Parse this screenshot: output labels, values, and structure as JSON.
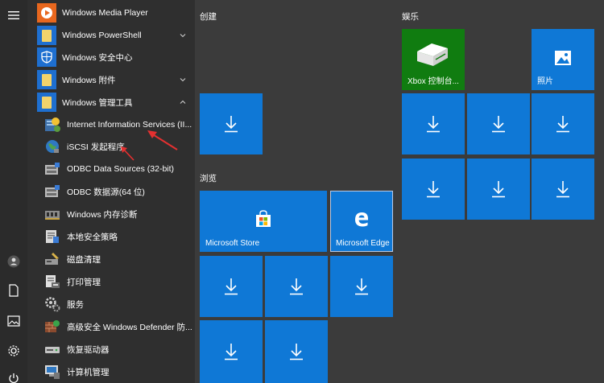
{
  "rail": {
    "icons": [
      "hamburger-icon",
      "user-icon",
      "document-icon",
      "picture-icon",
      "settings-icon",
      "power-icon"
    ]
  },
  "apps": [
    {
      "label": "Windows Media Player",
      "icon": "media-player-icon"
    },
    {
      "label": "Windows PowerShell",
      "icon": "folder-icon",
      "expand": "down"
    },
    {
      "label": "Windows 安全中心",
      "icon": "shield-icon"
    },
    {
      "label": "Windows 附件",
      "icon": "folder-icon",
      "expand": "down"
    },
    {
      "label": "Windows 管理工具",
      "icon": "folder-icon",
      "expand": "up"
    },
    {
      "label": "Internet Information Services (II...",
      "icon": "iis-icon"
    },
    {
      "label": "iSCSI 发起程序",
      "icon": "globe-icon"
    },
    {
      "label": "ODBC Data Sources (32-bit)",
      "icon": "odbc-icon"
    },
    {
      "label": "ODBC 数据源(64 位)",
      "icon": "odbc-icon"
    },
    {
      "label": "Windows 内存诊断",
      "icon": "memory-icon"
    },
    {
      "label": "本地安全策略",
      "icon": "policy-icon"
    },
    {
      "label": "磁盘清理",
      "icon": "disk-cleanup-icon"
    },
    {
      "label": "打印管理",
      "icon": "printer-icon"
    },
    {
      "label": "服务",
      "icon": "gears-icon"
    },
    {
      "label": "高级安全 Windows Defender 防...",
      "icon": "firewall-icon"
    },
    {
      "label": "恢复驱动器",
      "icon": "drive-icon"
    },
    {
      "label": "计算机管理",
      "icon": "computer-icon"
    }
  ],
  "groups": {
    "create": "创建",
    "browse": "浏览",
    "entertainment": "娱乐"
  },
  "tiles": {
    "xbox": "Xbox 控制台...",
    "photos": "照片",
    "store": "Microsoft Store",
    "edge": "Microsoft Edge"
  },
  "colors": {
    "tile_blue": "#0f78d6",
    "tile_green": "#107c10",
    "annotation_red": "#e53030",
    "folder_yellow": "#f3d36b"
  }
}
